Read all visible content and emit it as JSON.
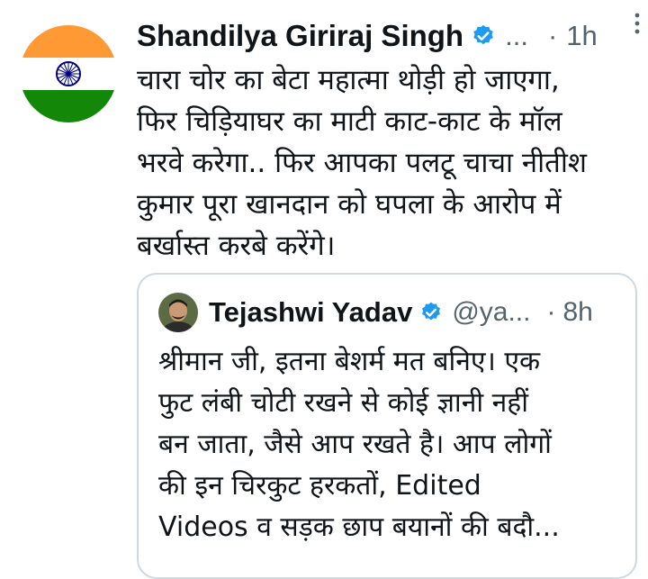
{
  "tweet": {
    "author_name": "Shandilya Giriraj Singh",
    "handle": "...",
    "time_separator": "·",
    "time": "1h",
    "text": "चारा चोर का बेटा महात्मा थोड़ी हो जाएगा,\nफिर चिड़ियाघर का माटी काट-काट के मॉल\nभरवे करेगा.. फिर आपका पलटू चाचा नीतीश\nकुमार पूरा खानदान को घपला के आरोप में\nबर्खास्त करबे करेंगे।",
    "avatar_icon": "india-flag-avatar-icon",
    "verified_icon": "verified-badge-icon",
    "more_icon": "more-options-icon"
  },
  "quoted_tweet": {
    "author_name": "Tejashwi Yadav",
    "handle": "@ya...",
    "time_separator": "·",
    "time": "8h",
    "text": "श्रीमान जी, इतना बेशर्म मत बनिए। एक\nफुट लंबी चोटी रखने से कोई ज्ञानी नहीं\nबन जाता, जैसे आप रखते है। आप लोगों\nकी इन चिरकुट हरकतों, Edited\nVideos व सड़क छाप बयानों की बदौ...",
    "avatar_icon": "profile-photo-avatar-icon",
    "verified_icon": "verified-badge-icon"
  },
  "colors": {
    "text_primary": "#0f1419",
    "text_secondary": "#536471",
    "verified_blue": "#1d9bf0",
    "border": "#cfd9de",
    "flag_saffron": "#ff9933",
    "flag_green": "#138808",
    "flag_chakra": "#000080"
  }
}
